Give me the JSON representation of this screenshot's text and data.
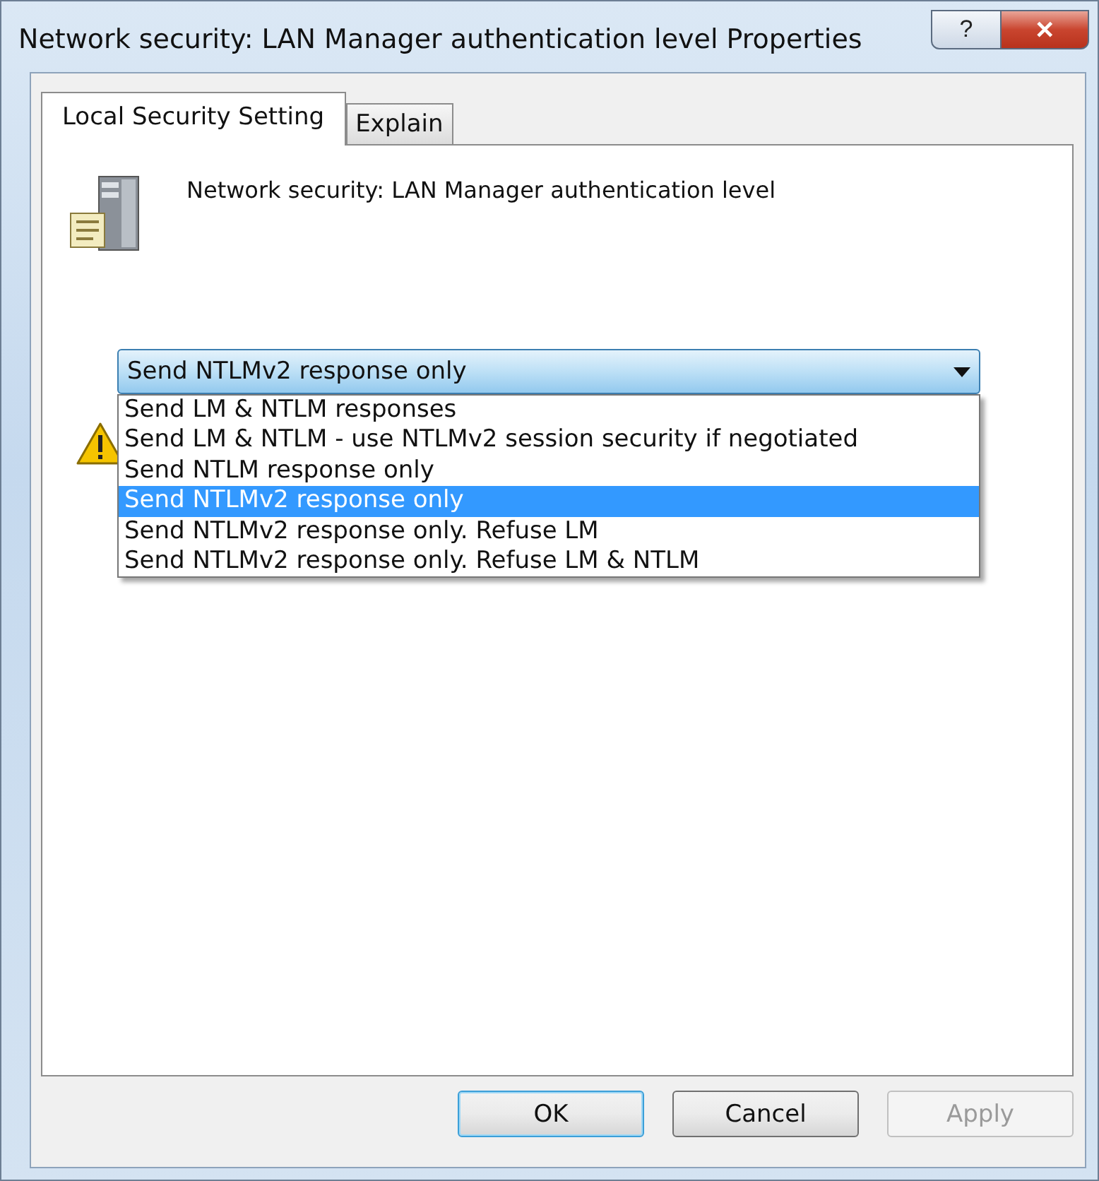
{
  "window": {
    "title": "Network security: LAN Manager authentication level Properties",
    "help_button": "?",
    "close_button": "✕"
  },
  "tabs": [
    {
      "label": "Local Security Setting",
      "selected": true
    },
    {
      "label": "Explain",
      "selected": false
    }
  ],
  "policy": {
    "name": "Network security: LAN Manager authentication level"
  },
  "dropdown": {
    "value": "Send NTLMv2 response only",
    "expanded": true,
    "options": [
      {
        "label": "Send LM & NTLM responses",
        "selected": false
      },
      {
        "label": "Send LM & NTLM - use NTLMv2 session security if negotiated",
        "selected": false
      },
      {
        "label": "Send NTLM response only",
        "selected": false
      },
      {
        "label": "Send NTLMv2 response only",
        "selected": true
      },
      {
        "label": "Send NTLMv2 response only. Refuse LM",
        "selected": false
      },
      {
        "label": "Send NTLMv2 response only. Refuse LM & NTLM",
        "selected": false
      }
    ]
  },
  "buttons": [
    {
      "label": "OK",
      "kind": "default",
      "disabled": false
    },
    {
      "label": "Cancel",
      "kind": "normal",
      "disabled": false
    },
    {
      "label": "Apply",
      "kind": "normal",
      "disabled": true
    }
  ]
}
